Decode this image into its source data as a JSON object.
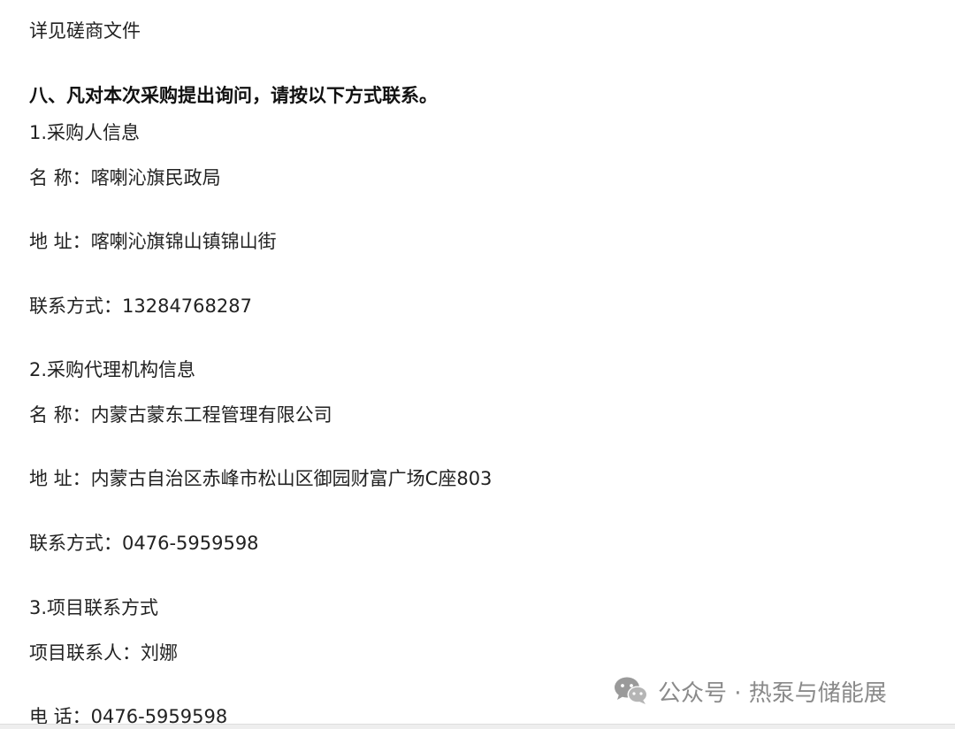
{
  "intro": "详见磋商文件",
  "section_heading": "八、凡对本次采购提出询问，请按以下方式联系。",
  "purchaser": {
    "heading": "1.采购人信息",
    "name": "名  称：喀喇沁旗民政局",
    "address": "地  址：喀喇沁旗锦山镇锦山街",
    "contact": "联系方式：13284768287"
  },
  "agency": {
    "heading": "2.采购代理机构信息",
    "name": "名  称：内蒙古蒙东工程管理有限公司",
    "address": "地  址：内蒙古自治区赤峰市松山区御园财富广场C座803",
    "contact": "联系方式：0476-5959598"
  },
  "project": {
    "heading": "3.项目联系方式",
    "person": "项目联系人：刘娜",
    "phone": "电  话：0476-5959598"
  },
  "watermark": {
    "text": "公众号 · 热泵与储能展",
    "icon": "wechat-icon"
  }
}
